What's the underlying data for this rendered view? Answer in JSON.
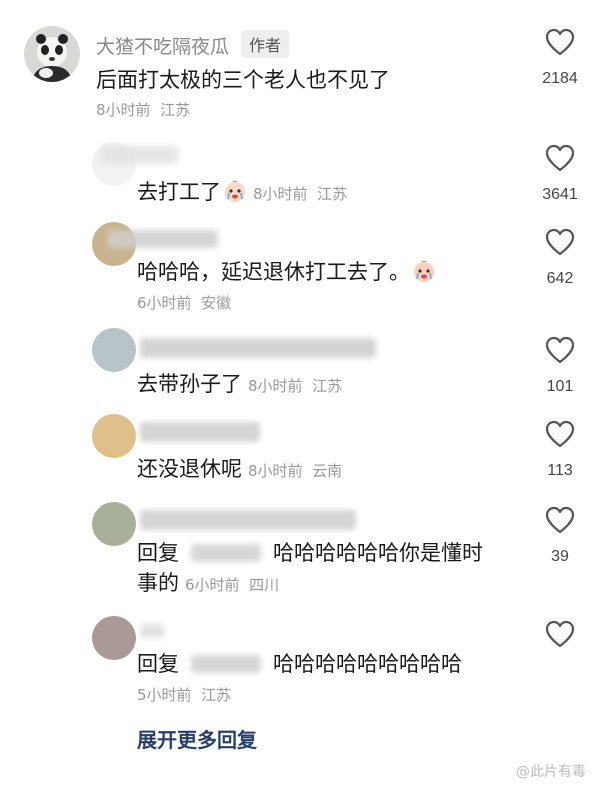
{
  "comments": [
    {
      "username": "大猹不吃隔夜瓜",
      "author_tag": "作者",
      "text": "后面打太极的三个老人也不见了",
      "time": "8小时前",
      "location": "江苏",
      "likes": "2184"
    },
    {
      "text": "去打工了",
      "time": "8小时前",
      "location": "江苏",
      "likes": "3641"
    },
    {
      "text": "哈哈哈，延迟退休打工去了。",
      "time": "6小时前",
      "location": "安徽",
      "likes": "642"
    },
    {
      "text": "去带孙子了",
      "time": "8小时前",
      "location": "江苏",
      "likes": "101"
    },
    {
      "text": "还没退休呢",
      "time": "8小时前",
      "location": "云南",
      "likes": "113"
    },
    {
      "reply_prefix": "回复",
      "text_line1": "哈哈哈哈哈哈你是懂时",
      "text_line2": "事的",
      "time": "6小时前",
      "location": "四川",
      "likes": "39"
    },
    {
      "reply_prefix": "回复",
      "text": "哈哈哈哈哈哈哈哈哈",
      "time": "5小时前",
      "location": "江苏"
    }
  ],
  "expand_more": "展开更多回复",
  "watermark": "@此片有毒"
}
